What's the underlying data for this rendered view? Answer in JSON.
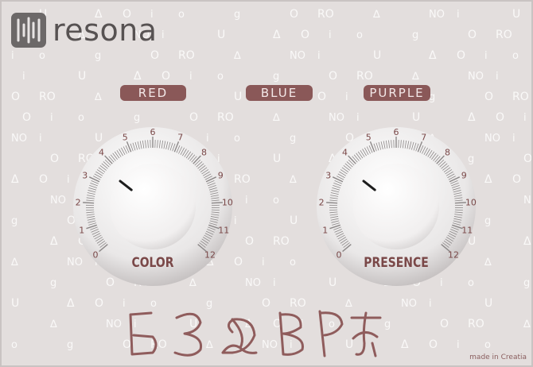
{
  "brand": {
    "name": "resona",
    "logo_icon": "resona-logo-icon"
  },
  "chips": [
    {
      "label": "RED"
    },
    {
      "label": "BLUE"
    },
    {
      "label": "PURPLE"
    }
  ],
  "knobs": [
    {
      "label": "COLOR",
      "scale": [
        "0",
        "1",
        "2",
        "3",
        "4",
        "5",
        "6",
        "7",
        "8",
        "9",
        "10",
        "11",
        "12"
      ],
      "value": 0.3
    },
    {
      "label": "PRESENCE",
      "scale": [
        "0",
        "1",
        "2",
        "3",
        "4",
        "5",
        "6",
        "7",
        "8",
        "9",
        "10",
        "11",
        "12"
      ],
      "value": 0.3
    }
  ],
  "signature": "БЗФВРӁ",
  "credit": "made in Creatia",
  "colors": {
    "panel": "#e3dedd",
    "chip": "#8a5858",
    "accent": "#7a4848",
    "pattern": "#ffffff"
  }
}
